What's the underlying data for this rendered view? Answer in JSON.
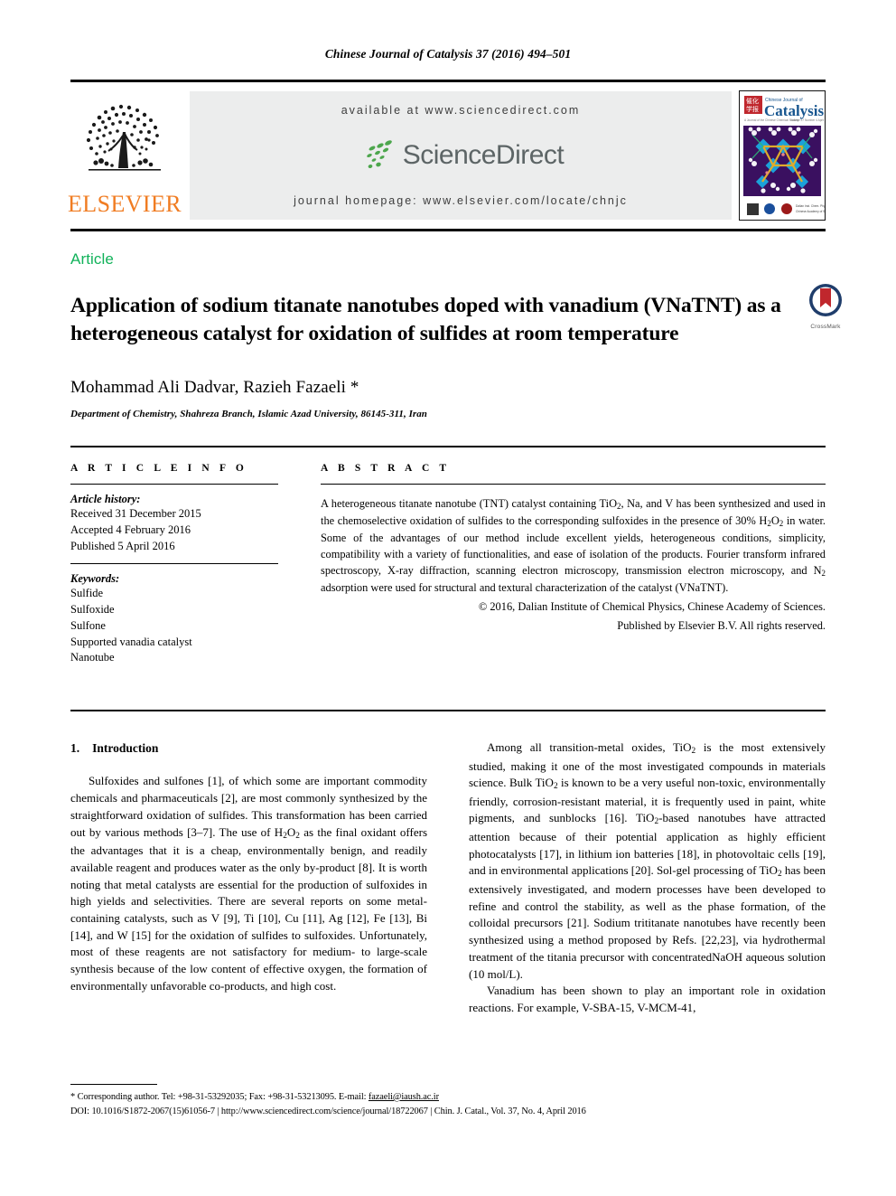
{
  "running_head": "Chinese Journal of Catalysis 37 (2016) 494–501",
  "masthead": {
    "publisher_wordmark": "ELSEVIER",
    "available_at": "available at www.sciencedirect.com",
    "sciencedirect_word": "ScienceDirect",
    "journal_homepage": "journal homepage: www.elsevier.com/locate/chnjc",
    "cover": {
      "journal_small_title": "Chinese Journal of",
      "journal_title": "Catalysis",
      "seal_text": "催化学报"
    },
    "colors": {
      "elsevier_orange": "#F07C22",
      "banner_grey": "#eceded",
      "sciencedirect_green": "#4CA64C",
      "sciencedirect_grey": "#5d6566"
    }
  },
  "article": {
    "kicker": "Article",
    "kicker_color": "#11b25a",
    "title": "Application of sodium titanate nanotubes doped with vanadium (VNaTNT) as a heterogeneous catalyst for oxidation of sulfides at room temperature",
    "authors": "Mohammad Ali Dadvar, Razieh Fazaeli *",
    "affiliation": "Department of Chemistry, Shahreza Branch, Islamic Azad University, 86145-311, Iran",
    "crossmark_label": "CrossMark"
  },
  "article_info": {
    "heading": "A R T I C L E   I N F O",
    "history_label": "Article history:",
    "history": [
      "Received 31 December 2015",
      "Accepted 4 February 2016",
      "Published 5 April 2016"
    ],
    "keywords_label": "Keywords:",
    "keywords": [
      "Sulfide",
      "Sulfoxide",
      "Sulfone",
      "Supported vanadia catalyst",
      "Nanotube"
    ]
  },
  "abstract": {
    "heading": "A B S T R A C T",
    "body_parts": [
      "A heterogeneous titanate nanotube (TNT) catalyst containing TiO",
      "2",
      ", Na, and V has been synthesized and used in the chemoselective oxidation of sulfides to the corresponding sulfoxides in the presence of 30% H",
      "2",
      "O",
      "2",
      " in water. Some of the advantages of our method include excellent yields, heterogeneous conditions, simplicity, compatibility with a variety of functionalities, and ease of isolation of the products. Fourier transform infrared spectroscopy, X-ray diffraction, scanning electron microscopy, transmission electron microscopy, and N",
      "2",
      " adsorption were used for structural and textural characterization of the catalyst (VNaTNT)."
    ],
    "copyright_line_1": "© 2016, Dalian Institute of Chemical Physics, Chinese Academy of Sciences.",
    "copyright_line_2": "Published by Elsevier B.V. All rights reserved."
  },
  "introduction": {
    "number": "1.",
    "heading": "Introduction"
  },
  "body": {
    "left_paragraph_1_pre": "Sulfoxides and sulfones [1], of which some are important commodity chemicals and pharmaceuticals [2], are most commonly synthesized by the straightforward oxidation of sulfides. This transformation has been carried out by various methods [3–7]. The use of H",
    "left_paragraph_1_sub1": "2",
    "left_paragraph_1_mid": "O",
    "left_paragraph_1_sub2": "2",
    "left_paragraph_1_post": " as the final oxidant offers the advantages that it is a cheap, environmentally benign, and readily available reagent and produces water as the only by-product [8]. It is worth noting that metal catalysts are essential for the production of sulfoxides in high yields and selectivities. There are several reports on some metal-containing catalysts, such as V [9], Ti [10], Cu [11], Ag [12], Fe [13], Bi [14], and W [15] for the oxidation of sulfides to sulfoxides. Unfortunately, most of these reagents are not satisfactory for medium- to large-scale synthesis because of the low content of effective oxygen, the formation of environmentally unfavorable co-products, and high cost.",
    "right_paragraph_1_a": "Among all transition-metal oxides, TiO",
    "right_paragraph_1_sub1": "2",
    "right_paragraph_1_b": " is the most extensively studied, making it one of the most investigated compounds in materials science. Bulk TiO",
    "right_paragraph_1_sub2": "2",
    "right_paragraph_1_c": " is known to be a very useful non-toxic, environmentally friendly, corrosion-resistant material, it is frequently used in paint, white pigments, and sunblocks [16]. TiO",
    "right_paragraph_1_sub3": "2",
    "right_paragraph_1_d": "-based nanotubes have attracted attention because of their potential application as highly efficient photocatalysts [17], in lithium ion batteries [18], in photovoltaic cells [19], and in environmental applications [20]. Sol-gel processing of TiO",
    "right_paragraph_1_sub4": "2",
    "right_paragraph_1_e": " has been extensively investigated, and modern processes have been developed to refine and control the stability, as well as the phase formation, of the colloidal precursors [21]. Sodium trititanate nanotubes have recently been synthesized using a method proposed by Refs. [22,23], via hydrothermal treatment of the titania precursor with concentratedNaOH aqueous solution (10 mol/L).",
    "right_paragraph_2": "Vanadium has been shown to play an important role in oxidation reactions. For example, V-SBA-15, V-MCM-41,"
  },
  "footnote": {
    "corresponding": "* Corresponding author. Tel: +98-31-53292035; Fax: +98-31-53213095. E-mail: ",
    "email": "fazaeli@iaush.ac.ir",
    "doi_line": "DOI: 10.1016/S1872-2067(15)61056-7 | http://www.sciencedirect.com/science/journal/18722067 | Chin. J. Catal., Vol. 37, No. 4, April 2016"
  }
}
